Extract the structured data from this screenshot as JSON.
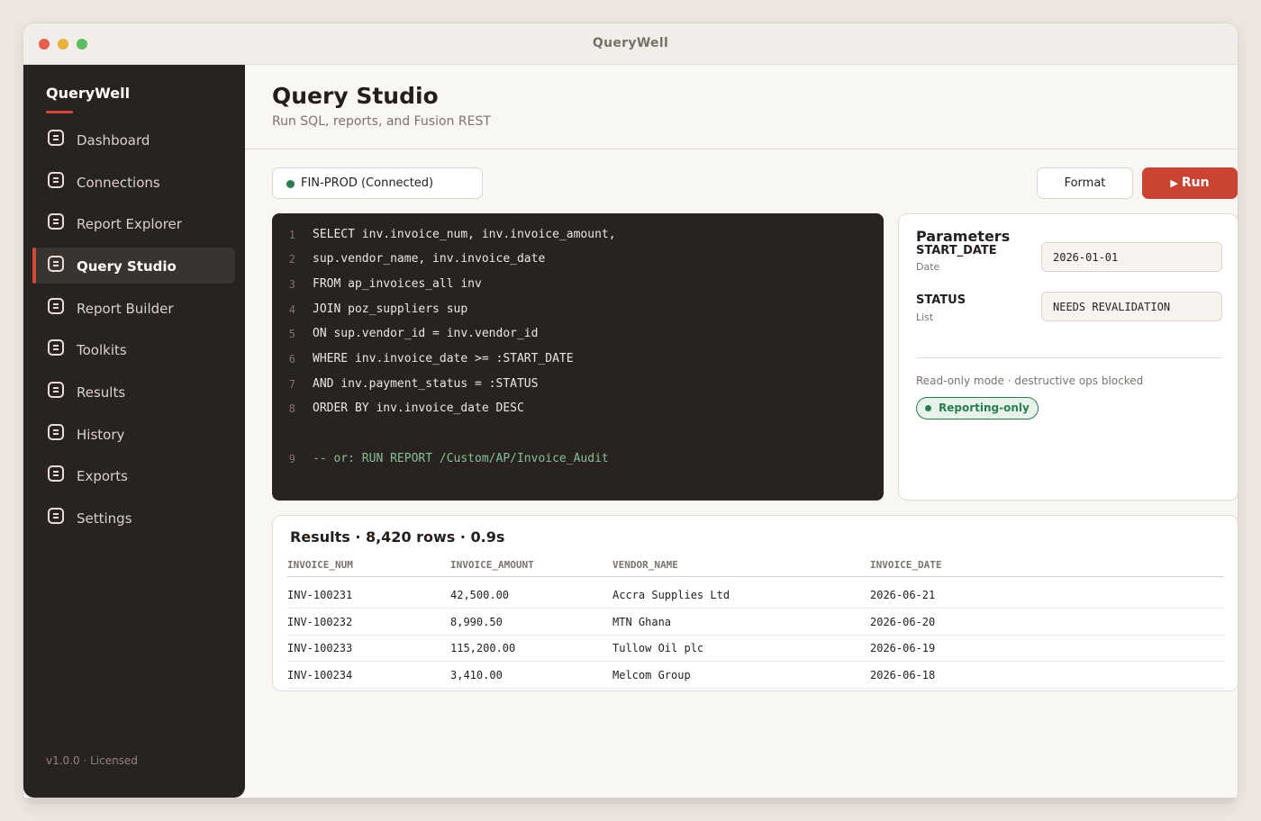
{
  "window": {
    "title": "QueryWell"
  },
  "sidebar": {
    "brand": "QueryWell",
    "items": [
      {
        "label": "Dashboard",
        "icon": "doc-icon",
        "active": false
      },
      {
        "label": "Connections",
        "icon": "doc-icon",
        "active": false
      },
      {
        "label": "Report Explorer",
        "icon": "doc-icon",
        "active": false
      },
      {
        "label": "Query Studio",
        "icon": "doc-icon",
        "active": true
      },
      {
        "label": "Report Builder",
        "icon": "doc-icon",
        "active": false
      },
      {
        "label": "Toolkits",
        "icon": "doc-icon",
        "active": false
      },
      {
        "label": "Results",
        "icon": "doc-icon",
        "active": false
      },
      {
        "label": "History",
        "icon": "doc-icon",
        "active": false
      },
      {
        "label": "Exports",
        "icon": "doc-icon",
        "active": false
      },
      {
        "label": "Settings",
        "icon": "doc-icon",
        "active": false
      }
    ],
    "version": "v1.0.0 · Licensed"
  },
  "header": {
    "title": "Query Studio",
    "subtitle": "Run SQL, reports, and Fusion REST"
  },
  "toolbar": {
    "connection_label": "FIN-PROD (Connected)",
    "connection_status_color": "#2a7d4f",
    "format_label": "Format",
    "run_icon": "▶",
    "run_label": "Run"
  },
  "editor": {
    "lines": [
      {
        "num": "1",
        "text": "SELECT inv.invoice_num, inv.invoice_amount,"
      },
      {
        "num": "2",
        "text": "sup.vendor_name, inv.invoice_date"
      },
      {
        "num": "3",
        "text": "FROM ap_invoices_all inv"
      },
      {
        "num": "4",
        "text": "JOIN poz_suppliers sup"
      },
      {
        "num": "5",
        "text": "ON sup.vendor_id = inv.vendor_id"
      },
      {
        "num": "6",
        "text": "WHERE inv.invoice_date >= :START_DATE"
      },
      {
        "num": "7",
        "text": "AND inv.payment_status = :STATUS"
      },
      {
        "num": "8",
        "text": "ORDER BY inv.invoice_date DESC"
      },
      {
        "num": "9",
        "text": "-- or: RUN REPORT /Custom/AP/Invoice_Audit"
      }
    ]
  },
  "params": {
    "title": "Parameters",
    "items": [
      {
        "name": "START_DATE",
        "type": "Date",
        "value": "2026-01-01"
      },
      {
        "name": "STATUS",
        "type": "List",
        "value": "NEEDS REVALIDATION"
      }
    ],
    "note": "Read-only mode · destructive ops blocked",
    "badge": "Reporting-only"
  },
  "results": {
    "title": "Results · 8,420 rows · 0.9s",
    "columns": [
      "INVOICE_NUM",
      "INVOICE_AMOUNT",
      "VENDOR_NAME",
      "INVOICE_DATE"
    ],
    "rows": [
      [
        "INV-100231",
        "42,500.00",
        "Accra Supplies Ltd",
        "2026-06-21"
      ],
      [
        "INV-100232",
        "8,990.50",
        "MTN Ghana",
        "2026-06-20"
      ],
      [
        "INV-100233",
        "115,200.00",
        "Tullow Oil plc",
        "2026-06-19"
      ],
      [
        "INV-100234",
        "3,410.00",
        "Melcom Group",
        "2026-06-18"
      ]
    ]
  },
  "colors": {
    "accent": "#c94433",
    "sidebar_bg": "#282321",
    "editor_bg": "#282321",
    "success": "#2a7d4f"
  }
}
